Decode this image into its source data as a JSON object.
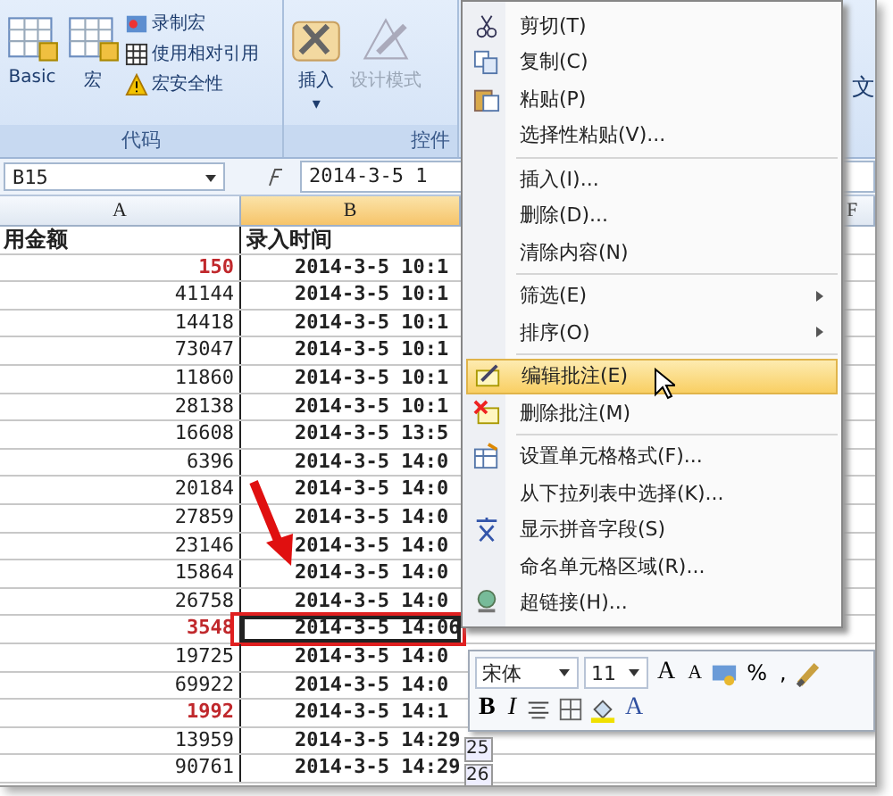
{
  "ribbon": {
    "groups": [
      {
        "label": "代码",
        "large_buttons": [
          {
            "label": "Basic",
            "disabled": false
          },
          {
            "label": "宏",
            "disabled": false
          }
        ],
        "small_buttons": [
          {
            "label": "录制宏"
          },
          {
            "label": "使用相对引用"
          },
          {
            "label": "宏安全性"
          }
        ]
      },
      {
        "label": "控件",
        "large_buttons": [
          {
            "label": "插入",
            "disabled": false,
            "dropdown": "▾"
          },
          {
            "label": "设计模式",
            "disabled": true
          }
        ]
      }
    ],
    "side_text": "文"
  },
  "formula_bar": {
    "name_box": "B15",
    "formula": "2014-3-5 1"
  },
  "columns": [
    {
      "label": "A",
      "selected": false
    },
    {
      "label": "B",
      "selected": true
    }
  ],
  "back_sheet": {
    "column": "F",
    "row_numbers": [
      "25",
      "26"
    ]
  },
  "header": {
    "amount": "用金额",
    "time": "录入时间"
  },
  "rows": [
    {
      "amount": "150",
      "time": "2014-3-5 10:1",
      "red": true,
      "selected": false
    },
    {
      "amount": "41144",
      "time": "2014-3-5 10:1",
      "red": false,
      "selected": false
    },
    {
      "amount": "14418",
      "time": "2014-3-5 10:1",
      "red": false,
      "selected": false
    },
    {
      "amount": "73047",
      "time": "2014-3-5 10:1",
      "red": false,
      "selected": false
    },
    {
      "amount": "11860",
      "time": "2014-3-5 10:1",
      "red": false,
      "selected": false
    },
    {
      "amount": "28138",
      "time": "2014-3-5 10:1",
      "red": false,
      "selected": false
    },
    {
      "amount": "16608",
      "time": "2014-3-5 13:5",
      "red": false,
      "selected": false
    },
    {
      "amount": "6396",
      "time": "2014-3-5 14:0",
      "red": false,
      "selected": false
    },
    {
      "amount": "20184",
      "time": "2014-3-5 14:0",
      "red": false,
      "selected": false
    },
    {
      "amount": "27859",
      "time": "2014-3-5 14:0",
      "red": false,
      "selected": false
    },
    {
      "amount": "23146",
      "time": "2014-3-5 14:0",
      "red": false,
      "selected": false
    },
    {
      "amount": "15864",
      "time": "2014-3-5 14:0",
      "red": false,
      "selected": false
    },
    {
      "amount": "26758",
      "time": "2014-3-5 14:0",
      "red": false,
      "selected": false
    },
    {
      "amount": "3548",
      "time": "2014-3-5 14:06",
      "red": true,
      "selected": true
    },
    {
      "amount": "19725",
      "time": "2014-3-5 14:0",
      "red": false,
      "selected": false
    },
    {
      "amount": "69922",
      "time": "2014-3-5 14:0",
      "red": false,
      "selected": false
    },
    {
      "amount": "1992",
      "time": "2014-3-5 14:1",
      "red": true,
      "selected": false
    },
    {
      "amount": "13959",
      "time": "2014-3-5 14:29",
      "red": false,
      "selected": false
    },
    {
      "amount": "90761",
      "time": "2014-3-5 14:29",
      "red": false,
      "selected": false
    }
  ],
  "context_menu": {
    "items": [
      {
        "kind": "item",
        "label": "剪切(T)",
        "submenu": false,
        "selected": false
      },
      {
        "kind": "item",
        "label": "复制(C)",
        "submenu": false,
        "selected": false
      },
      {
        "kind": "item",
        "label": "粘贴(P)",
        "submenu": false,
        "selected": false
      },
      {
        "kind": "item",
        "label": "选择性粘贴(V)...",
        "submenu": false,
        "selected": false
      },
      {
        "kind": "separator"
      },
      {
        "kind": "item",
        "label": "插入(I)...",
        "submenu": false,
        "selected": false
      },
      {
        "kind": "item",
        "label": "删除(D)...",
        "submenu": false,
        "selected": false
      },
      {
        "kind": "item",
        "label": "清除内容(N)",
        "submenu": false,
        "selected": false
      },
      {
        "kind": "separator"
      },
      {
        "kind": "item",
        "label": "筛选(E)",
        "submenu": true,
        "selected": false
      },
      {
        "kind": "item",
        "label": "排序(O)",
        "submenu": true,
        "selected": false
      },
      {
        "kind": "separator"
      },
      {
        "kind": "item",
        "label": "编辑批注(E)",
        "submenu": false,
        "selected": true
      },
      {
        "kind": "item",
        "label": "删除批注(M)",
        "submenu": false,
        "selected": false
      },
      {
        "kind": "separator"
      },
      {
        "kind": "item",
        "label": "设置单元格格式(F)...",
        "submenu": false,
        "selected": false
      },
      {
        "kind": "item",
        "label": "从下拉列表中选择(K)...",
        "submenu": false,
        "selected": false
      },
      {
        "kind": "item",
        "label": "显示拼音字段(S)",
        "submenu": false,
        "selected": false
      },
      {
        "kind": "item",
        "label": "命名单元格区域(R)...",
        "submenu": false,
        "selected": false
      },
      {
        "kind": "item",
        "label": "超链接(H)...",
        "submenu": false,
        "selected": false
      }
    ]
  },
  "mini_toolbar": {
    "font": "宋体",
    "size": "11",
    "grow_font": "A",
    "shrink_font": "A",
    "percent": "%",
    "comma": ",",
    "bold": "B",
    "italic": "I",
    "font_color": "A"
  }
}
